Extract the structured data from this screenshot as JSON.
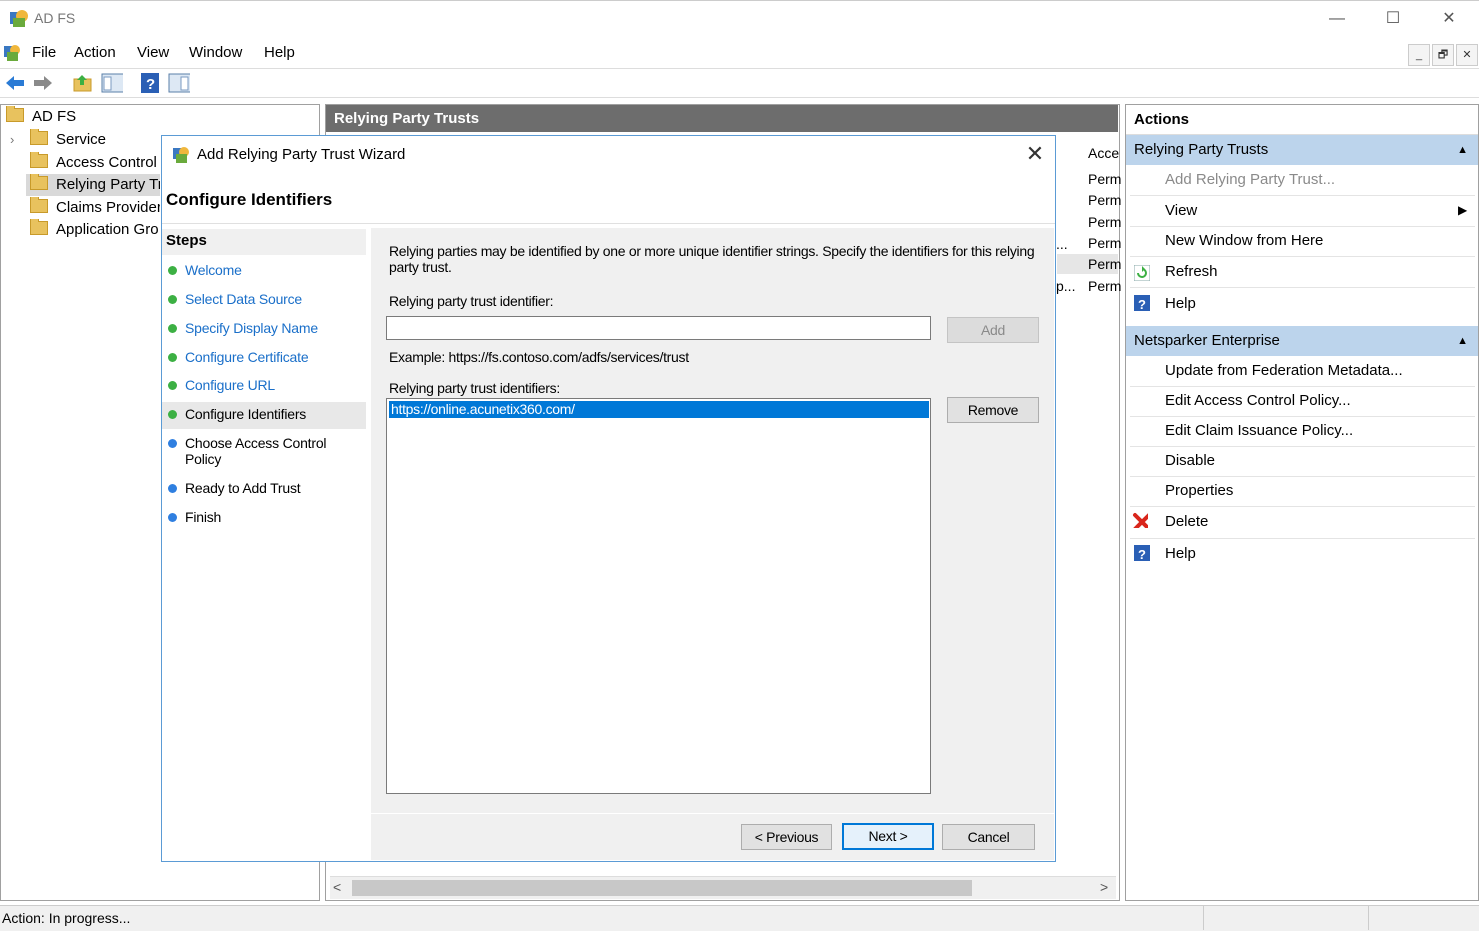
{
  "window": {
    "title": "AD FS",
    "controls": {
      "minimize": "—",
      "maximize": "☐",
      "close": "✕"
    }
  },
  "menubar": {
    "items": [
      "File",
      "Action",
      "View",
      "Window",
      "Help"
    ],
    "mdi_controls": [
      "_",
      "🗗",
      "✕"
    ]
  },
  "tree": {
    "root": "AD FS",
    "items": [
      {
        "label": "Service",
        "expandable": true
      },
      {
        "label": "Access Control P"
      },
      {
        "label": "Relying Party Tr",
        "selected": true
      },
      {
        "label": "Claims Provider"
      },
      {
        "label": "Application Gro"
      }
    ]
  },
  "center": {
    "header": "Relying Party Trusts",
    "column_header": "Acce",
    "rows": [
      "Perm",
      "Perm",
      "Perm",
      "Perm",
      "Perm",
      "Perm"
    ],
    "row_prefixes": [
      "...",
      "p..."
    ]
  },
  "actions": {
    "header": "Actions",
    "sections": [
      {
        "title": "Relying Party Trusts",
        "items": [
          {
            "label": "Add Relying Party Trust...",
            "disabled": true,
            "icon": ""
          },
          {
            "label": "View",
            "submenu": true,
            "icon": ""
          },
          {
            "label": "New Window from Here",
            "icon": ""
          },
          {
            "label": "Refresh",
            "icon": "refresh-icon"
          },
          {
            "label": "Help",
            "icon": "help-icon"
          }
        ]
      },
      {
        "title": "Netsparker Enterprise",
        "items": [
          {
            "label": "Update from Federation Metadata...",
            "icon": ""
          },
          {
            "label": "Edit Access Control Policy...",
            "icon": ""
          },
          {
            "label": "Edit Claim Issuance Policy...",
            "icon": ""
          },
          {
            "label": "Disable",
            "icon": ""
          },
          {
            "label": "Properties",
            "icon": ""
          },
          {
            "label": "Delete",
            "icon": "delete-icon"
          },
          {
            "label": "Help",
            "icon": "help-icon"
          }
        ]
      }
    ]
  },
  "statusbar": {
    "text": "Action:  In progress..."
  },
  "dialog": {
    "title": "Add Relying Party Trust Wizard",
    "heading": "Configure Identifiers",
    "steps_title": "Steps",
    "steps": [
      {
        "label": "Welcome",
        "state": "done"
      },
      {
        "label": "Select Data Source",
        "state": "done"
      },
      {
        "label": "Specify Display Name",
        "state": "done"
      },
      {
        "label": "Configure Certificate",
        "state": "done"
      },
      {
        "label": "Configure URL",
        "state": "done"
      },
      {
        "label": "Configure Identifiers",
        "state": "active"
      },
      {
        "label": "Choose Access Control",
        "label2": "Policy",
        "state": "todo"
      },
      {
        "label": "Ready to Add Trust",
        "state": "todo"
      },
      {
        "label": "Finish",
        "state": "todo"
      }
    ],
    "description_line1": "Relying parties may be identified by one or more unique identifier strings. Specify the identifiers for this relying",
    "description_line2": "party trust.",
    "identifier_label": "Relying party trust identifier:",
    "identifier_value": "",
    "add_button": "Add",
    "example": "Example: https://fs.contoso.com/adfs/services/trust",
    "identifiers_label": "Relying party trust identifiers:",
    "identifiers": [
      "https://online.acunetix360.com/"
    ],
    "remove_button": "Remove",
    "previous_button": "< Previous",
    "next_button": "Next >",
    "cancel_button": "Cancel"
  },
  "colors": {
    "section_header_bg": "#bcd4ec",
    "center_header_bg": "#6d6d6d",
    "selection_blue": "#0078d7",
    "step_done_link": "#1a6fc9",
    "dot_green": "#3cb043",
    "dot_blue": "#2f7fe0"
  }
}
